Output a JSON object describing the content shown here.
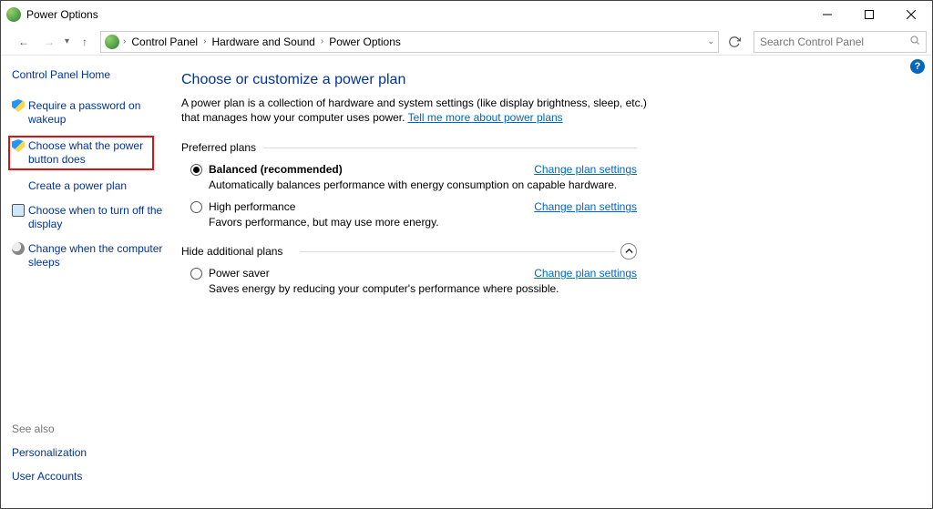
{
  "window": {
    "title": "Power Options"
  },
  "breadcrumbs": {
    "a": "Control Panel",
    "b": "Hardware and Sound",
    "c": "Power Options"
  },
  "search": {
    "placeholder": "Search Control Panel"
  },
  "sidebar": {
    "home": "Control Panel Home",
    "items": [
      {
        "label": "Require a password on wakeup",
        "icon": "shield",
        "highlight": false
      },
      {
        "label": "Choose what the power button does",
        "icon": "shield",
        "highlight": true
      },
      {
        "label": "Create a power plan",
        "icon": "",
        "highlight": false
      },
      {
        "label": "Choose when to turn off the display",
        "icon": "monitor",
        "highlight": false
      },
      {
        "label": "Change when the computer sleeps",
        "icon": "moon",
        "highlight": false
      }
    ],
    "see_also_label": "See also",
    "see_also": [
      {
        "label": "Personalization"
      },
      {
        "label": "User Accounts"
      }
    ]
  },
  "main": {
    "heading": "Choose or customize a power plan",
    "description": "A power plan is a collection of hardware and system settings (like display brightness, sleep, etc.) that manages how your computer uses power. ",
    "desc_link": "Tell me more about power plans",
    "preferred_label": "Preferred plans",
    "hide_label": "Hide additional plans",
    "change_link": "Change plan settings",
    "plans": {
      "balanced": {
        "name": "Balanced (recommended)",
        "desc": "Automatically balances performance with energy consumption on capable hardware."
      },
      "high": {
        "name": "High performance",
        "desc": "Favors performance, but may use more energy."
      },
      "saver": {
        "name": "Power saver",
        "desc": "Saves energy by reducing your computer's performance where possible."
      }
    }
  }
}
